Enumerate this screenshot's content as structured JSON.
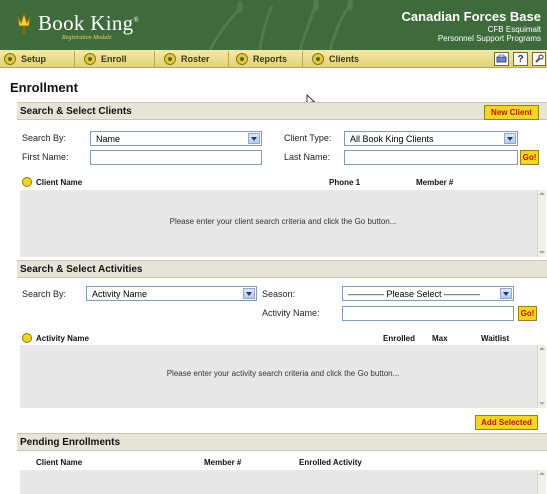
{
  "app": {
    "name": "Book King",
    "trademark": "®",
    "subtitle": "Registration Module"
  },
  "organization": {
    "name": "Canadian Forces Base",
    "line2": "CFB Esquimalt",
    "line3": "Personnel Support Programs"
  },
  "nav": {
    "setup": "Setup",
    "enroll": "Enroll",
    "roster": "Roster",
    "reports": "Reports",
    "clients": "Clients",
    "help": "?"
  },
  "page_title": "Enrollment",
  "clients_section": {
    "title": "Search & Select Clients",
    "new_client": "New Client",
    "search_by_label": "Search By:",
    "search_by_value": "Name",
    "client_type_label": "Client Type:",
    "client_type_value": "All Book King Clients",
    "first_name_label": "First Name:",
    "first_name_value": "",
    "last_name_label": "Last Name:",
    "last_name_value": "",
    "go": "Go!",
    "columns": [
      "Client Name",
      "Phone 1",
      "Member #"
    ],
    "message": "Please enter your client search criteria and click the Go button..."
  },
  "activities_section": {
    "title": "Search & Select Activities",
    "search_by_label": "Search By:",
    "search_by_value": "Activity Name",
    "season_label": "Season:",
    "season_value": "———— Please Select ————",
    "activity_name_label": "Activity Name:",
    "activity_name_value": "",
    "go": "Go!",
    "columns": [
      "Activity Name",
      "Enrolled",
      "Max",
      "Waitlist"
    ],
    "message": "Please enter your activity search criteria and click the Go button...",
    "add_selected": "Add Selected"
  },
  "pending_section": {
    "title": "Pending Enrollments",
    "columns": [
      "Client Name",
      "Member #",
      "Enrolled Activity"
    ]
  },
  "colors": {
    "header_green": "#3e6a3c",
    "nav_yellow": "#e3d27a",
    "button_yellow": "#f5d428",
    "button_text": "#b01b00",
    "section_bg": "#e5e4d6",
    "results_bg": "#e8e8e8"
  }
}
